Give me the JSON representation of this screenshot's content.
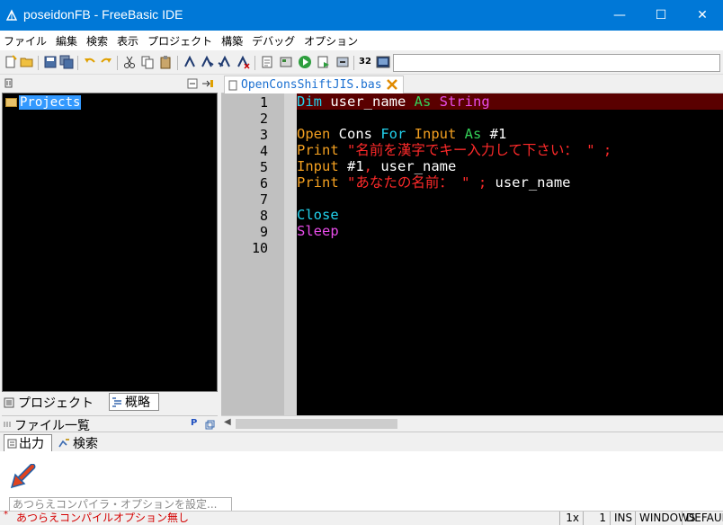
{
  "window": {
    "title": "poseidonFB - FreeBasic IDE",
    "minimize": "—",
    "maximize": "☐",
    "close": "✕"
  },
  "menu": [
    "ファイル",
    "編集",
    "検索",
    "表示",
    "プロジェクト",
    "構築",
    "デバッグ",
    "オプション"
  ],
  "toolbar": {
    "bits_label": "32"
  },
  "left_panel": {
    "tree_root": "Projects",
    "tab_project": "プロジェクト",
    "tab_outline": "概略",
    "files_header": "ファイル一覧",
    "files_p": "P"
  },
  "editor": {
    "tab_filename": "OpenConsShiftJIS.bas",
    "line_numbers": [
      "1",
      "2",
      "3",
      "4",
      "5",
      "6",
      "7",
      "8",
      "9",
      "10"
    ],
    "lines": [
      [
        {
          "t": "Dim ",
          "c": "#22d3ee"
        },
        {
          "t": "user_name ",
          "c": "#ffffff"
        },
        {
          "t": "As ",
          "c": "#34d058"
        },
        {
          "t": "String",
          "c": "#e84cea"
        }
      ],
      [],
      [
        {
          "t": "Open ",
          "c": "#f29f20"
        },
        {
          "t": "Cons ",
          "c": "#ffffff"
        },
        {
          "t": "For ",
          "c": "#22d3ee"
        },
        {
          "t": "Input ",
          "c": "#f29f20"
        },
        {
          "t": "As ",
          "c": "#34d058"
        },
        {
          "t": "#1",
          "c": "#ffffff"
        }
      ],
      [
        {
          "t": "Print ",
          "c": "#f29f20"
        },
        {
          "t": "\"名前を漢字でキー入力して下さい： \" ;",
          "c": "#ff2a2a"
        }
      ],
      [
        {
          "t": "Input ",
          "c": "#f29f20"
        },
        {
          "t": "#1",
          "c": "#ffffff"
        },
        {
          "t": ", ",
          "c": "#ff2a2a"
        },
        {
          "t": "user_name",
          "c": "#ffffff"
        }
      ],
      [
        {
          "t": "Print ",
          "c": "#f29f20"
        },
        {
          "t": "\"あなたの名前： \" ; ",
          "c": "#ff2a2a"
        },
        {
          "t": "user_name",
          "c": "#ffffff"
        }
      ],
      [],
      [
        {
          "t": "Close",
          "c": "#22d3ee"
        }
      ],
      [
        {
          "t": "Sleep",
          "c": "#e84cea"
        }
      ],
      []
    ]
  },
  "output": {
    "tab_output": "出力",
    "tab_search": "検索",
    "option_placeholder": "あつらえコンパイラ・オプションを設定...",
    "status_message": "あつらえコンパイルオプション無し"
  },
  "status": {
    "zoom": "1x",
    "line": "1",
    "mode": "INS",
    "eol": "WINDOWS",
    "encoding": "DEFAULT"
  },
  "colors": {
    "titlebar": "#0078d7",
    "editor_bg": "#000000",
    "current_line": "#5a0000",
    "tree_selection": "#3399ff",
    "status_message": "#d40000"
  }
}
